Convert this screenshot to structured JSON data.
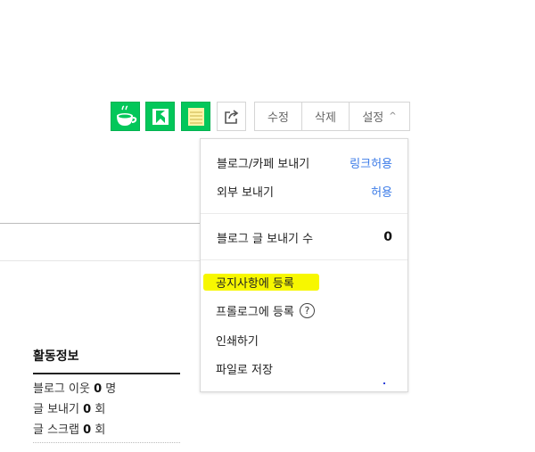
{
  "toolbar": {
    "icons": [
      "cafe-icon",
      "kakao-icon",
      "memo-icon",
      "share-icon"
    ],
    "edit_label": "수정",
    "delete_label": "삭제",
    "settings_label": "설정",
    "settings_caret": "^"
  },
  "settings_menu": {
    "send_blog_cafe": {
      "label": "블로그/카페 보내기",
      "value": "링크허용"
    },
    "send_external": {
      "label": "외부 보내기",
      "value": "허용"
    },
    "send_count": {
      "label": "블로그 글 보내기 수",
      "value": "0"
    },
    "register_notice": "공지사항에 등록",
    "register_prologue": "프롤로그에 등록",
    "help_glyph": "?",
    "print": "인쇄하기",
    "save_file": "파일로 저장"
  },
  "activity": {
    "title": "활동정보",
    "neighbors": {
      "label": "블로그 이웃",
      "count": "0",
      "unit": "명"
    },
    "sent": {
      "label": "글 보내기",
      "count": "0",
      "unit": "회"
    },
    "scraps": {
      "label": "글 스크랩",
      "count": "0",
      "unit": "회"
    }
  },
  "colors": {
    "green": "#03c75a",
    "link_blue": "#3b7be8",
    "highlight": "#f7f700"
  }
}
